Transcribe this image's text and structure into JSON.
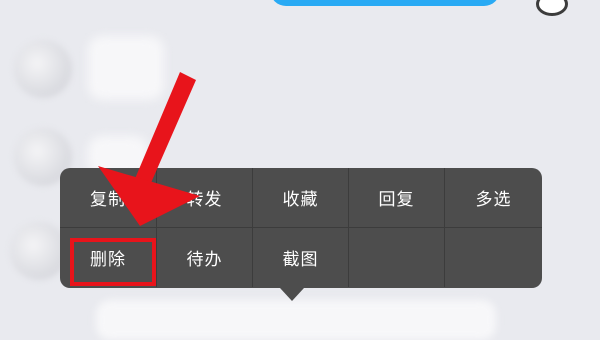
{
  "context_menu": {
    "row1": [
      "复制",
      "转发",
      "收藏",
      "回复",
      "多选"
    ],
    "row2": [
      "删除",
      "待办",
      "截图"
    ]
  },
  "annotation": {
    "color": "#e8141b",
    "highlighted_item": "删除"
  },
  "colors": {
    "menu_background": "#4d4d4d",
    "sent_bubble": "#29aaf4",
    "chat_background": "#e9eaef"
  }
}
